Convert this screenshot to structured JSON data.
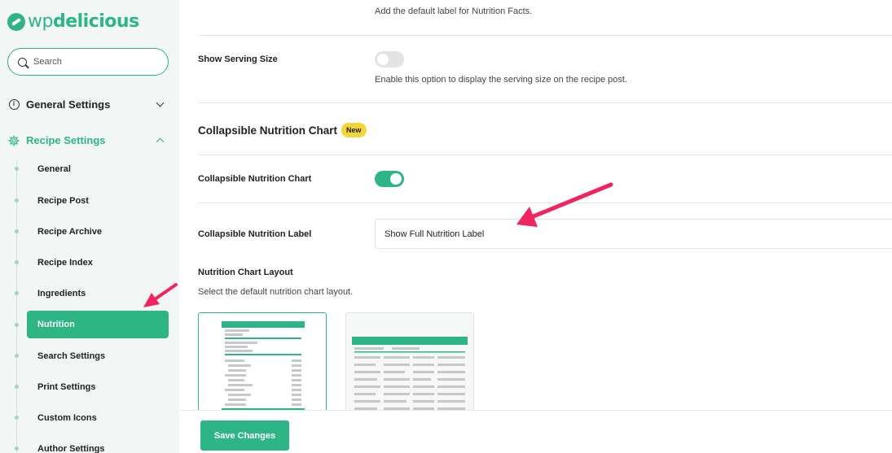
{
  "brand": {
    "logo_wp": "wp",
    "logo_delicious": "delicious"
  },
  "search": {
    "placeholder": "Search"
  },
  "sidebar": {
    "general_settings": "General Settings",
    "recipe_settings": "Recipe Settings",
    "items": [
      {
        "label": "General"
      },
      {
        "label": "Recipe Post"
      },
      {
        "label": "Recipe Archive"
      },
      {
        "label": "Recipe Index"
      },
      {
        "label": "Ingredients"
      },
      {
        "label": "Nutrition",
        "active": true
      },
      {
        "label": "Search Settings"
      },
      {
        "label": "Print Settings"
      },
      {
        "label": "Custom Icons"
      },
      {
        "label": "Author Settings"
      }
    ]
  },
  "main": {
    "nutrition_label_desc": "Add the default label for Nutrition Facts.",
    "show_serving_size": {
      "label": "Show Serving Size",
      "desc": "Enable this option to display the serving size on the recipe post.",
      "enabled": false
    },
    "collapsible_section": {
      "title": "Collapsible Nutrition Chart",
      "badge": "New"
    },
    "collapsible_chart": {
      "label": "Collapsible Nutrition Chart",
      "enabled": true
    },
    "collapsible_label": {
      "label": "Collapsible Nutrition Label",
      "value": "Show Full Nutrition Label"
    },
    "chart_layout": {
      "label": "Nutrition Chart Layout",
      "desc": "Select the default nutrition chart layout."
    }
  },
  "footer": {
    "save_label": "Save Changes"
  },
  "colors": {
    "accent": "#2db586",
    "badge": "#f4d638",
    "arrow": "#f0245e"
  }
}
